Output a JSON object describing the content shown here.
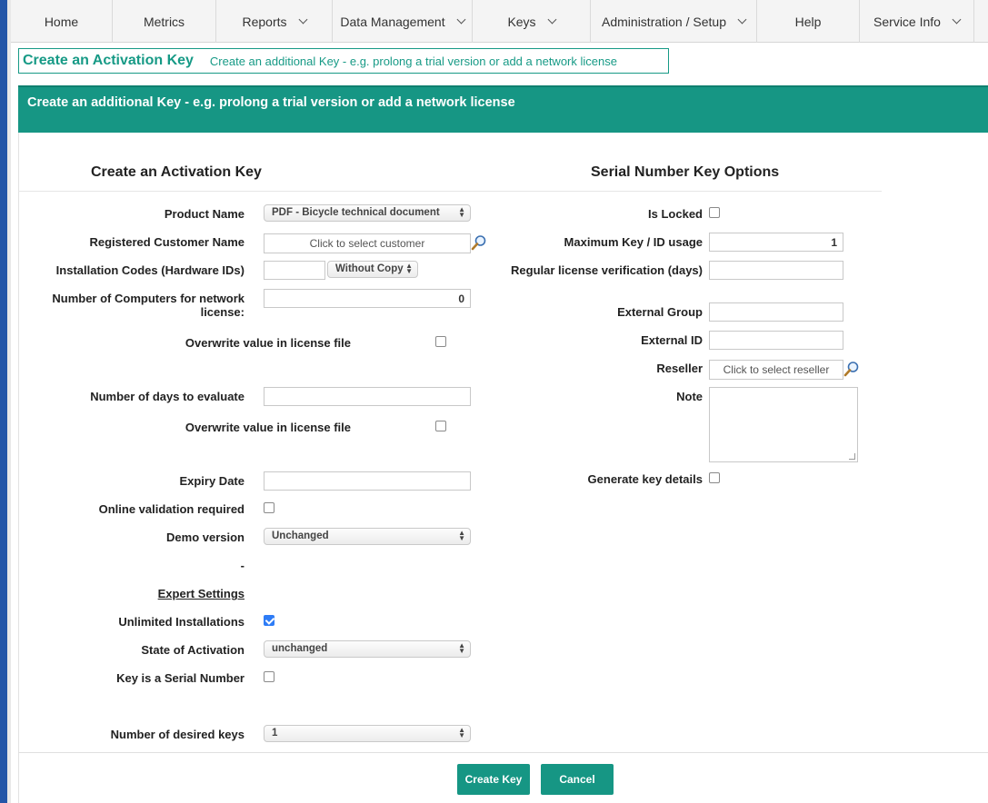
{
  "nav": {
    "home": "Home",
    "metrics": "Metrics",
    "reports": "Reports",
    "data_management": "Data Management",
    "keys": "Keys",
    "administration": "Administration / Setup",
    "help": "Help",
    "service_info": "Service Info"
  },
  "header": {
    "title": "Create an Activation Key",
    "subtitle": "Create an additional Key - e.g. prolong a trial version or add a network license"
  },
  "banner": {
    "text": "Create an additional Key - e.g. prolong a trial version or add a network license"
  },
  "left": {
    "section_title": "Create an Activation Key",
    "product_name": {
      "label": "Product Name",
      "value": "PDF - Bicycle technical document"
    },
    "customer": {
      "label": "Registered Customer Name",
      "placeholder": "Click to select customer"
    },
    "installation_codes": {
      "label": "Installation Codes (Hardware IDs)",
      "value": "",
      "copy_option": "Without Copy"
    },
    "network_computers": {
      "label": "Number of Computers for network license:",
      "value": "0"
    },
    "overwrite_1": {
      "label": "Overwrite value in license file",
      "checked": false
    },
    "days_evaluate": {
      "label": "Number of days to evaluate",
      "value": ""
    },
    "overwrite_2": {
      "label": "Overwrite value in license file",
      "checked": false
    },
    "expiry_date": {
      "label": "Expiry Date",
      "value": ""
    },
    "online_validation": {
      "label": "Online validation required",
      "checked": false
    },
    "demo_version": {
      "label": "Demo version",
      "value": "Unchanged"
    },
    "dash": "-",
    "expert_settings": "Expert Settings",
    "unlimited_installations": {
      "label": "Unlimited Installations",
      "checked": true
    },
    "state_activation": {
      "label": "State of Activation",
      "value": "unchanged"
    },
    "serial_number": {
      "label": "Key is a Serial Number",
      "checked": false
    },
    "desired_keys": {
      "label": "Number of desired keys",
      "value": "1"
    }
  },
  "right": {
    "section_title": "Serial Number Key Options",
    "is_locked": {
      "label": "Is Locked",
      "checked": false
    },
    "max_usage": {
      "label": "Maximum Key / ID usage",
      "value": "1"
    },
    "regular_verification": {
      "label": "Regular license verification (days)",
      "value": ""
    },
    "external_group": {
      "label": "External Group",
      "value": ""
    },
    "external_id": {
      "label": "External ID",
      "value": ""
    },
    "reseller": {
      "label": "Reseller",
      "placeholder": "Click to select reseller"
    },
    "note": {
      "label": "Note",
      "value": ""
    },
    "generate_details": {
      "label": "Generate key details",
      "checked": false
    }
  },
  "buttons": {
    "create": "Create Key",
    "cancel": "Cancel"
  },
  "colors": {
    "accent": "#169684",
    "checkbox_checked": "#2e7cf6",
    "left_edge": "#2356a8"
  },
  "icons": {
    "lookup": "magnifier-icon",
    "dropdown": "chevron-down-icon",
    "select_arrows": "updown-arrows-icon"
  }
}
